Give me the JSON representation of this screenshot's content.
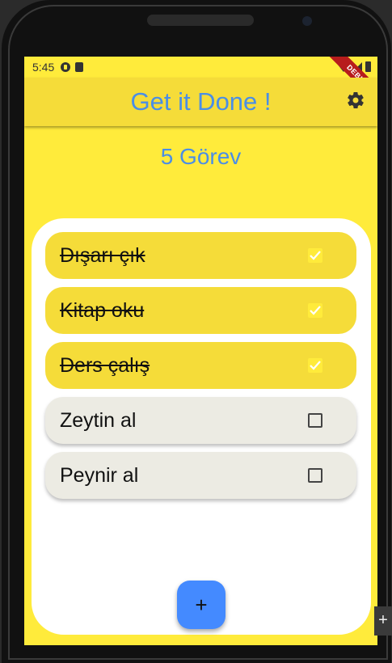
{
  "status_bar": {
    "time": "5:45"
  },
  "debug_banner": "DEBUG",
  "app_bar": {
    "title": "Get it Done !"
  },
  "task_count": "5 Görev",
  "tasks": [
    {
      "label": "Dışarı çık",
      "done": true
    },
    {
      "label": "Kitap oku",
      "done": true
    },
    {
      "label": "Ders çalış",
      "done": true
    },
    {
      "label": "Zeytin al",
      "done": false
    },
    {
      "label": "Peynir al",
      "done": false
    }
  ],
  "fab": {
    "icon": "plus-icon",
    "glyph": "+"
  },
  "side_toolbar": {
    "glyph": "+"
  },
  "colors": {
    "background": "#FFEB3B",
    "app_bar": "#F5DC39",
    "accent_text": "#4A8EE6",
    "fab": "#448AFF",
    "todo_card": "#ECEBE3"
  }
}
